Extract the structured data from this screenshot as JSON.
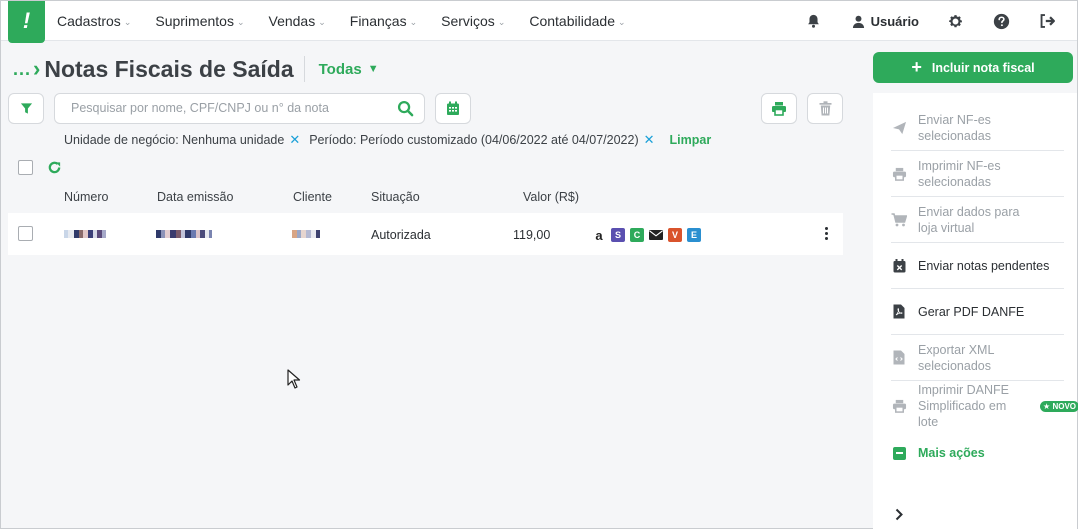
{
  "nav": {
    "items": [
      {
        "label": "Cadastros"
      },
      {
        "label": "Suprimentos"
      },
      {
        "label": "Vendas"
      },
      {
        "label": "Finanças"
      },
      {
        "label": "Serviços"
      },
      {
        "label": "Contabilidade"
      }
    ],
    "user_label": "Usuário",
    "logo_text": "!"
  },
  "header": {
    "breadcrumb_dots": "...",
    "title": "Notas Fiscais de Saída",
    "status_filter": "Todas"
  },
  "search": {
    "placeholder": "Pesquisar por nome, CPF/CNPJ ou n° da nota",
    "value": ""
  },
  "filters": {
    "chips": [
      {
        "label": "Unidade de negócio: Nenhuma unidade"
      },
      {
        "label": "Período: Período customizado (04/06/2022 até 04/07/2022)"
      }
    ],
    "clear_label": "Limpar"
  },
  "table": {
    "columns": [
      "Número",
      "Data emissão",
      "Cliente",
      "Situação",
      "Valor (R$)"
    ],
    "rows": [
      {
        "situacao": "Autorizada",
        "valor": "119,00",
        "badges": [
          "a",
          "S",
          "C",
          "envelope",
          "V",
          "E"
        ]
      }
    ]
  },
  "sidebar": {
    "primary_button": "Incluir nota fiscal",
    "items": [
      {
        "label": "Enviar NF-es selecionadas",
        "icon": "send-icon",
        "enabled": false
      },
      {
        "label": "Imprimir NF-es selecionadas",
        "icon": "printer-icon",
        "enabled": false
      },
      {
        "label": "Enviar dados para loja virtual",
        "icon": "cart-icon",
        "enabled": false
      },
      {
        "label": "Enviar notas pendentes",
        "icon": "calendar-x-icon",
        "enabled": true
      },
      {
        "label": "Gerar PDF DANFE",
        "icon": "pdf-file-icon",
        "enabled": true
      },
      {
        "label": "Exportar XML selecionados",
        "icon": "code-file-icon",
        "enabled": false
      },
      {
        "label": "Imprimir DANFE Simplificado em lote",
        "icon": "printer-icon",
        "enabled": false
      }
    ],
    "novo_badge": "★ NOVO",
    "more_actions": "Mais ações"
  },
  "colors": {
    "brand": "#2eaa5b",
    "accent_blue": "#1aa0d8"
  }
}
